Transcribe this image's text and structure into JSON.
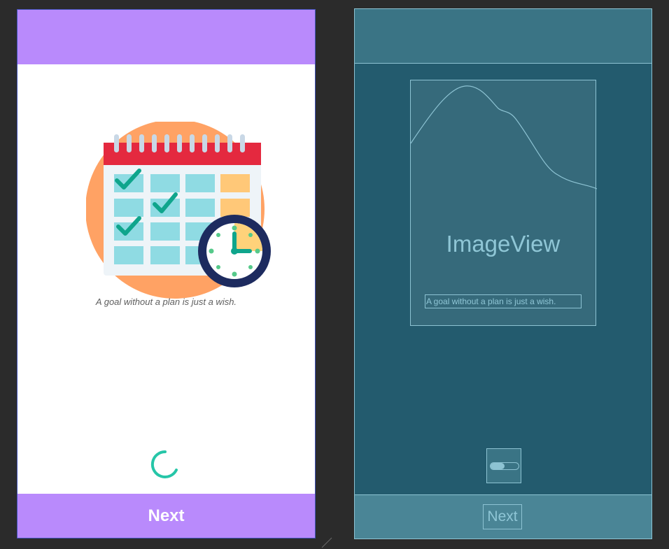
{
  "design": {
    "quote_text": "A goal without a plan is just a wish.",
    "next_label": "Next",
    "colors": {
      "bar": "#b98afc",
      "spinner": "#26c6a8",
      "calendar_header": "#e4293f",
      "calendar_cell": "#8fdbe3",
      "check": "#0fa58c",
      "clock_ring": "#1d2b5f",
      "circle_bg": "#ffa264"
    },
    "illustration_icon": "calendar-clock-illustration"
  },
  "blueprint": {
    "imageview_label": "ImageView",
    "quote_text": "A goal without a plan is just a wish.",
    "next_label": "Next",
    "progress_icon": "switch-toggle-icon"
  }
}
